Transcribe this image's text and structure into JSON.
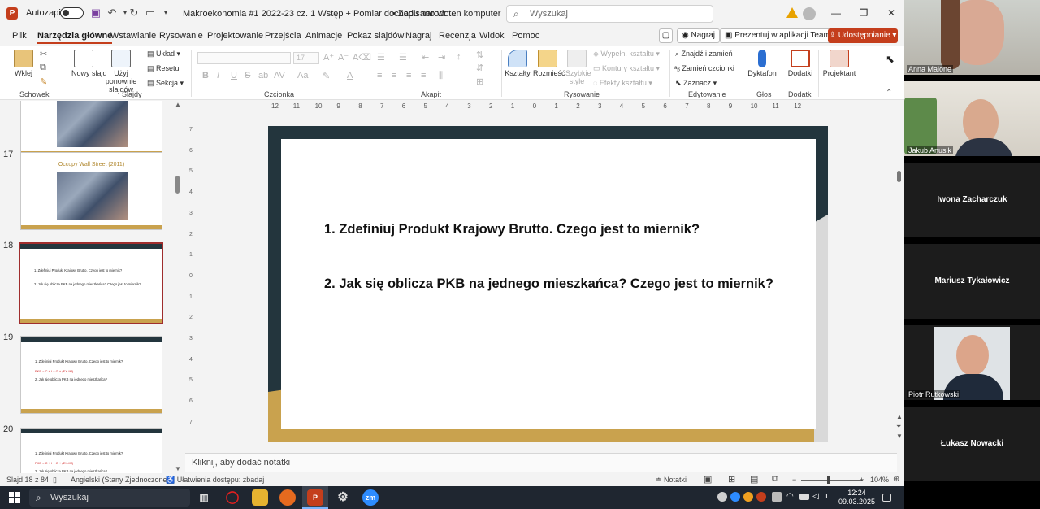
{
  "titlebar": {
    "logo": "P",
    "autosave_label": "Autozapis",
    "doc_title": "Makroekonomia #1 2022-23 cz. 1 Wstęp + Pomiar dochodu narodo...",
    "saved_status": "• Zapisano w: ten komputer",
    "search_placeholder": "Wyszukaj",
    "minimize": "—",
    "restore": "❐",
    "close": "✕"
  },
  "menu": {
    "tabs": [
      "Plik",
      "Narzędzia główne",
      "Wstawianie",
      "Rysowanie",
      "Projektowanie",
      "Przejścia",
      "Animacje",
      "Pokaz slajdów",
      "Nagraj",
      "Recenzja",
      "Widok",
      "Pomoc"
    ],
    "record_label": "Nagraj",
    "present_teams": "Prezentuj w aplikacji Teams",
    "share": "Udostępnianie"
  },
  "ribbon": {
    "clipboard": {
      "paste": "Wklej",
      "group": "Schowek"
    },
    "slides": {
      "new_slide": "Nowy slajd",
      "reuse": "Użyj ponownie slajdów",
      "layout": "Układ",
      "reset": "Resetuj",
      "section": "Sekcja",
      "group": "Slajdy"
    },
    "font": {
      "size": "17",
      "group": "Czcionka",
      "bold": "B",
      "italic": "I",
      "underline": "U",
      "strike": "S",
      "shadow": "ab",
      "spacing": "AV",
      "case": "Aa"
    },
    "paragraph": {
      "group": "Akapit"
    },
    "drawing": {
      "shapes": "Kształty",
      "arrange": "Rozmieść",
      "quick_styles": "Szybkie style",
      "fill": "Wypełn. kształtu",
      "outline": "Kontury kształtu",
      "effects": "Efekty kształtu",
      "group": "Rysowanie"
    },
    "editing": {
      "find": "Znajdź i zamień",
      "replace": "Zamień czcionki",
      "select": "Zaznacz",
      "group": "Edytowanie"
    },
    "voice": {
      "dictate": "Dyktafon",
      "group": "Głos"
    },
    "addins": {
      "addins": "Dodatki",
      "group": "Dodatki"
    },
    "designer": {
      "label": "Projektant"
    }
  },
  "ruler": {
    "h": [
      "12",
      "11",
      "10",
      "9",
      "8",
      "7",
      "6",
      "5",
      "4",
      "3",
      "2",
      "1",
      "0",
      "1",
      "2",
      "3",
      "4",
      "5",
      "6",
      "7",
      "8",
      "9",
      "10",
      "11",
      "12"
    ],
    "v": [
      "7",
      "6",
      "5",
      "4",
      "3",
      "2",
      "1",
      "0",
      "1",
      "2",
      "3",
      "4",
      "5",
      "6",
      "7"
    ]
  },
  "thumbnails": [
    {
      "num": "",
      "type": "photo",
      "title": ""
    },
    {
      "num": "17",
      "type": "photo",
      "title": "Occupy Wall Street (2011)"
    },
    {
      "num": "18",
      "type": "text",
      "selected": true,
      "lines": [
        "1. Zdefiniuj Produkt Krajowy Brutto. Czego jest to miernik?",
        "2. Jak się oblicza PKB na jednego mieszkańca? Czego jest to miernik?"
      ]
    },
    {
      "num": "19",
      "type": "text",
      "lines": [
        "1. Zdefiniuj Produkt Krajowy Brutto. Czego jest to miernik?",
        "PKB = C + I + G + (EX-IM)",
        "2. Jak się oblicza PKB na jednego mieszkańca?"
      ]
    },
    {
      "num": "20",
      "type": "text",
      "lines": [
        "1. Zdefiniuj Produkt Krajowy Brutto. Czego jest to miernik?",
        "PKB = C + I + G + (EX-IM)",
        "2. Jak się oblicza PKB na jednego mieszkańca?"
      ]
    }
  ],
  "slide": {
    "q1": "1. Zdefiniuj Produkt Krajowy Brutto. Czego jest to miernik?",
    "q2": "2. Jak się oblicza PKB na jednego mieszkańca? Czego jest to miernik?"
  },
  "notes_placeholder": "Kliknij, aby dodać notatki",
  "status": {
    "slide": "Slajd 18 z 84",
    "language": "Angielski (Stany Zjednoczone)",
    "accessibility": "Ułatwienia dostępu: zbadaj",
    "notes": "Notatki",
    "zoom": "104%"
  },
  "taskbar": {
    "search_placeholder": "Wyszukaj",
    "time": "12:24",
    "date": "09.03.2025"
  },
  "participants": [
    {
      "name": "Anna Malone",
      "video": true
    },
    {
      "name": "Jakub Anusik",
      "video": true
    },
    {
      "name": "Iwona Zacharczuk",
      "video": false
    },
    {
      "name": "Mariusz Tykałowicz",
      "video": false
    },
    {
      "name": "Piotr Rutkowski",
      "video": true
    },
    {
      "name": "Łukasz Nowacki",
      "video": false
    }
  ],
  "colors": {
    "accent": "#c43e1c",
    "slide_dark": "#23353d",
    "slide_gold": "#c9a24e"
  }
}
